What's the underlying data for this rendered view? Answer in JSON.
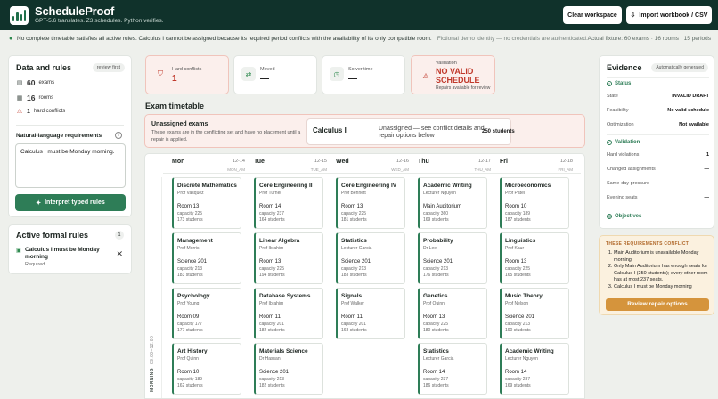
{
  "header": {
    "title": "ScheduleProof",
    "subtitle": "GPT-5.6 translates. Z3 schedules. Python verifies.",
    "clear_label": "Clear workspace",
    "import_label": "Import workbook / CSV"
  },
  "status": {
    "message": "No complete timetable satisfies all active rules. Calculus I cannot be assigned because its required period conflicts with the availability of its only compatible room.",
    "demo_note": "Fictional demo identity — no credentials are authenticated.",
    "fixture": "Actual fixture: 60 exams · 16 rooms · 15 periods"
  },
  "data_rules": {
    "title": "Data and rules",
    "badge": "review first",
    "stats": [
      {
        "value": "60",
        "label": "exams"
      },
      {
        "value": "16",
        "label": "rooms"
      },
      {
        "value": "1",
        "label": "hard conflicts"
      }
    ],
    "nl_label": "Natural-language requirements",
    "nl_value": "Calculus I must be Monday morning.",
    "interpret_label": "Interpret typed rules"
  },
  "active_rules": {
    "title": "Active formal rules",
    "count": "1",
    "items": [
      {
        "text": "Calculus I must be Monday morning",
        "status": "Required"
      }
    ]
  },
  "kpis": {
    "hard": {
      "label": "Hard conflicts",
      "value": "1"
    },
    "moved": {
      "label": "Moved",
      "value": "—"
    },
    "solver": {
      "label": "Solver time",
      "value": "—"
    },
    "validation": {
      "label": "Validation",
      "value": "NO VALID SCHEDULE",
      "sub": "Repairs available for review"
    }
  },
  "timetable": {
    "title": "Exam timetable",
    "unassigned": {
      "title": "Unassigned exams",
      "desc": "These exams are in the conflicting set and have no placement until a repair is applied.",
      "exam": "Calculus I",
      "msg": "Unassigned — see conflict details and repair options below",
      "students": "250 students"
    },
    "slot_label": "MORNING",
    "slot_time": "09:00–12:00",
    "days": [
      {
        "name": "Mon",
        "date": "12-14",
        "code": "MON_AM"
      },
      {
        "name": "Tue",
        "date": "12-15",
        "code": "TUE_AM"
      },
      {
        "name": "Wed",
        "date": "12-16",
        "code": "WED_AM"
      },
      {
        "name": "Thu",
        "date": "12-17",
        "code": "THU_AM"
      },
      {
        "name": "Fri",
        "date": "12-18",
        "code": "FRI_AM"
      }
    ],
    "columns": [
      [
        {
          "name": "Discrete Mathematics",
          "prof": "Prof Vasquez",
          "room": "Room 13",
          "cap": "capacity 225",
          "stu": "173 students"
        },
        {
          "name": "Management",
          "prof": "Prof Morris",
          "room": "Science 201",
          "cap": "capacity 213",
          "stu": "183 students"
        },
        {
          "name": "Psychology",
          "prof": "Prof Young",
          "room": "Room 09",
          "cap": "capacity 177",
          "stu": "177 students"
        },
        {
          "name": "Art History",
          "prof": "Prof Quinn",
          "room": "Room 10",
          "cap": "capacity 189",
          "stu": "162 students"
        }
      ],
      [
        {
          "name": "Core Engineering II",
          "prof": "Prof Turner",
          "room": "Room 14",
          "cap": "capacity 237",
          "stu": "164 students"
        },
        {
          "name": "Linear Algebra",
          "prof": "Prof Ibrahim",
          "room": "Room 13",
          "cap": "capacity 225",
          "stu": "194 students"
        },
        {
          "name": "Database Systems",
          "prof": "Prof Ibrahim",
          "room": "Room 11",
          "cap": "capacity 201",
          "stu": "182 students"
        },
        {
          "name": "Materials Science",
          "prof": "Dr Hassan",
          "room": "Science 201",
          "cap": "capacity 213",
          "stu": "182 students"
        }
      ],
      [
        {
          "name": "Core Engineering IV",
          "prof": "Prof Bennett",
          "room": "Room 13",
          "cap": "capacity 225",
          "stu": "181 students"
        },
        {
          "name": "Statistics",
          "prof": "Lecturer Garcia",
          "room": "Science 201",
          "cap": "capacity 213",
          "stu": "183 students"
        },
        {
          "name": "Signals",
          "prof": "Prof Walker",
          "room": "Room 11",
          "cap": "capacity 201",
          "stu": "168 students"
        }
      ],
      [
        {
          "name": "Academic Writing",
          "prof": "Lecturer Nguyen",
          "room": "Main Auditorium",
          "cap": "capacity 360",
          "stu": "169 students"
        },
        {
          "name": "Probability",
          "prof": "Dr Lee",
          "room": "Science 201",
          "cap": "capacity 213",
          "stu": "176 students"
        },
        {
          "name": "Genetics",
          "prof": "Prof Quinn",
          "room": "Room 13",
          "cap": "capacity 225",
          "stu": "180 students"
        },
        {
          "name": "Statistics",
          "prof": "Lecturer Garcia",
          "room": "Room 14",
          "cap": "capacity 237",
          "stu": "186 students"
        }
      ],
      [
        {
          "name": "Microeconomics",
          "prof": "Prof Patel",
          "room": "Room 10",
          "cap": "capacity 189",
          "stu": "187 students"
        },
        {
          "name": "Linguistics",
          "prof": "Prof Kaur",
          "room": "Room 13",
          "cap": "capacity 225",
          "stu": "165 students"
        },
        {
          "name": "Music Theory",
          "prof": "Prof Nelson",
          "room": "Science 201",
          "cap": "capacity 213",
          "stu": "190 students"
        },
        {
          "name": "Academic Writing",
          "prof": "Lecturer Nguyen",
          "room": "Room 14",
          "cap": "capacity 237",
          "stu": "169 students"
        }
      ]
    ]
  },
  "evidence": {
    "title": "Evidence",
    "badge": "Automatically generated",
    "status_head": "Status",
    "state_label": "State",
    "state_value": "INVALID DRAFT",
    "feas_label": "Feasibility",
    "feas_value": "No valid schedule",
    "opt_label": "Optimization",
    "opt_value": "Not available",
    "valid_head": "Validation",
    "hv_label": "Hard violations",
    "hv_value": "1",
    "ca_label": "Changed assignments",
    "ca_value": "—",
    "sd_label": "Same-day pressure",
    "sd_value": "—",
    "es_label": "Evening seats",
    "es_value": "—",
    "obj_head": "Objectives"
  },
  "conflict": {
    "title": "THESE REQUIREMENTS CONFLICT",
    "items": [
      "Main Auditorium is unavailable Monday morning",
      "Only Main Auditorium has enough seats for Calculus I (250 students); every other room has at most 237 seats.",
      "Calculus I must be Monday morning"
    ],
    "button": "Review repair options"
  },
  "colors": {
    "brand": "#10322b",
    "accent": "#2e7d57",
    "alert": "#c0392b",
    "warn": "#d5943c"
  }
}
